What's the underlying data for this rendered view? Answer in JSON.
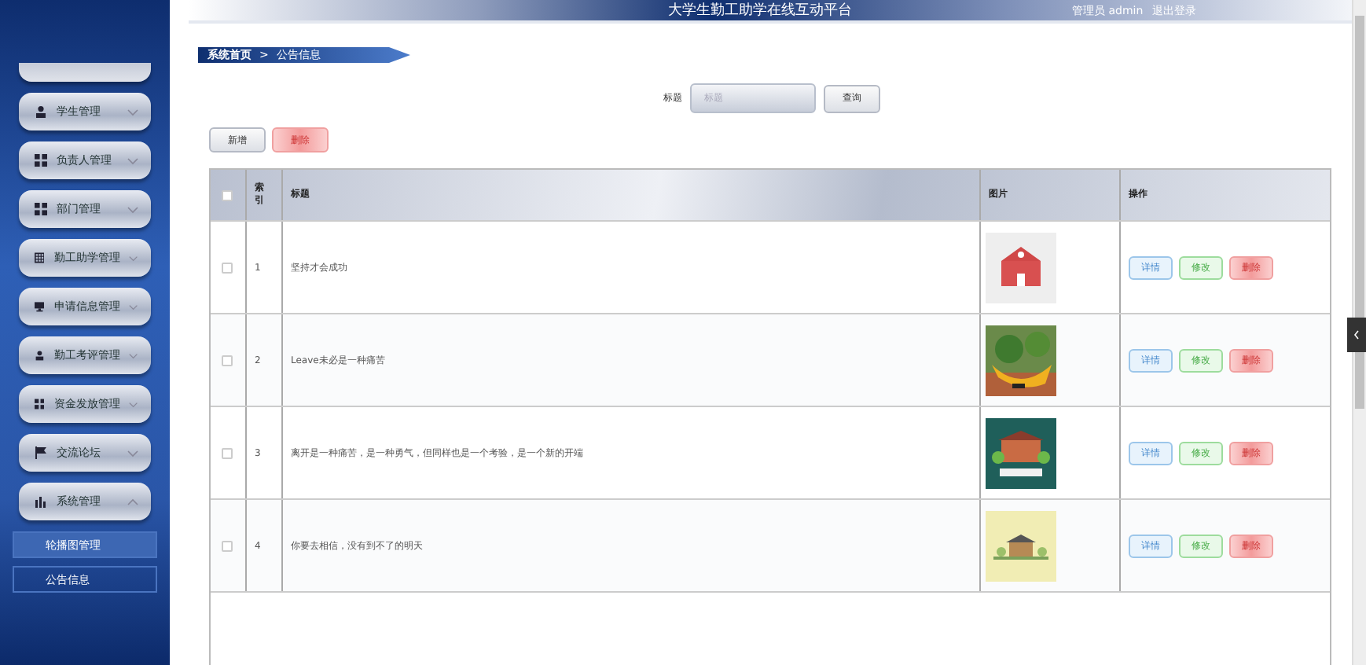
{
  "header": {
    "title": "大学生勤工助学在线互动平台",
    "user": "管理员 admin",
    "logout": "退出登录"
  },
  "sidebar": {
    "items": [
      {
        "label": "学生管理",
        "expanded": false
      },
      {
        "label": "负责人管理",
        "expanded": false
      },
      {
        "label": "部门管理",
        "expanded": false
      },
      {
        "label": "勤工助学管理",
        "expanded": false
      },
      {
        "label": "申请信息管理",
        "expanded": false
      },
      {
        "label": "勤工考评管理",
        "expanded": false
      },
      {
        "label": "资金发放管理",
        "expanded": false
      },
      {
        "label": "交流论坛",
        "expanded": false
      },
      {
        "label": "系统管理",
        "expanded": true,
        "children": [
          {
            "label": "轮播图管理",
            "selected": true
          },
          {
            "label": "公告信息",
            "selected": false
          }
        ]
      }
    ]
  },
  "breadcrumb": [
    "系统首页",
    ">",
    "公告信息"
  ],
  "search": {
    "label": "标题",
    "placeholder": "标题",
    "button": "查询"
  },
  "actions": [
    "新增",
    "删除"
  ],
  "table": {
    "all_checked": false,
    "columns": [
      "索引",
      "标题",
      "图片",
      "操作"
    ],
    "rows": [
      {
        "index": "1",
        "title": "坚持才会成功",
        "picture": {
          "kind": "picture"
        },
        "checked": false,
        "actions": [
          "详情",
          "修改",
          "删除"
        ]
      },
      {
        "index": "2",
        "title": "Leave未必是一种痛苦",
        "picture": {
          "kind": "picture"
        },
        "checked": false,
        "actions": [
          "详情",
          "修改",
          "删除"
        ]
      },
      {
        "index": "3",
        "title": "离开是一种痛苦，是一种勇气，但同样也是一个考验，是一个新的开端",
        "picture": {
          "kind": "picture"
        },
        "checked": false,
        "actions": [
          "详情",
          "修改",
          "删除"
        ]
      },
      {
        "index": "4",
        "title": "你要去相信，没有到不了的明天",
        "picture": {
          "kind": "picture"
        },
        "checked": false,
        "actions": [
          "详情",
          "修改",
          "删除"
        ]
      }
    ]
  }
}
